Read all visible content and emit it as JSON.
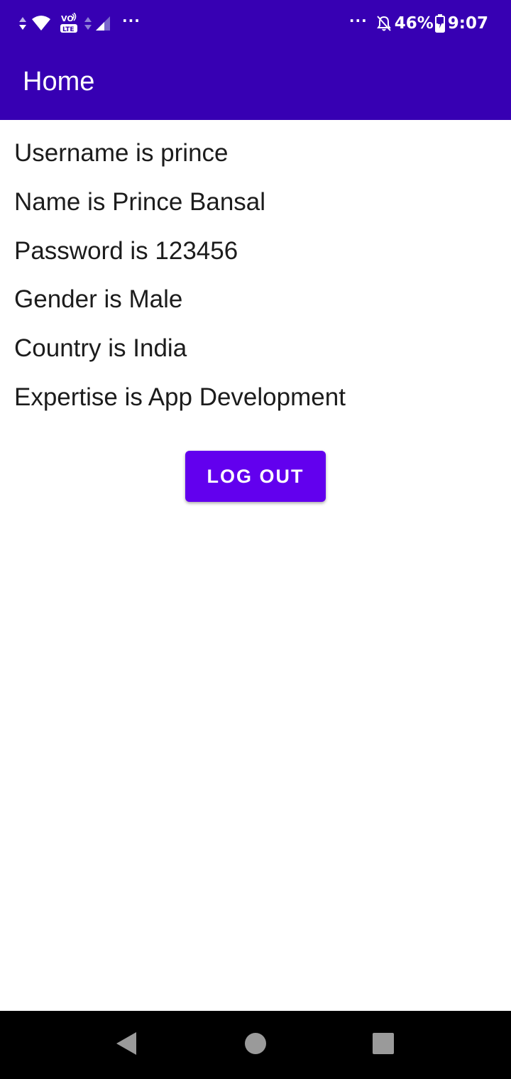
{
  "status_bar": {
    "battery_percent": "46%",
    "time": "9:07",
    "left_dots": "···",
    "right_dots": "···",
    "icons": [
      "data-arrows-icon",
      "wifi-icon",
      "volte-icon",
      "signal-arrows-icon",
      "cell-signal-icon",
      "mute-bell-icon",
      "battery-icon"
    ],
    "volte_label_top": "VO",
    "volte_label_bottom": "LTE"
  },
  "app_bar": {
    "title": "Home"
  },
  "profile": {
    "username_line": "Username is prince",
    "name_line": "Name is Prince Bansal",
    "password_line": "Password is 123456",
    "gender_line": "Gender is Male",
    "country_line": "Country is India",
    "expertise_line": "Expertise is App Development"
  },
  "actions": {
    "logout_label": "LOG OUT"
  },
  "nav_bar": {
    "icons": [
      "back-icon",
      "home-icon",
      "recents-icon"
    ]
  },
  "colors": {
    "app_bar": "#3700b3",
    "button": "#6200ee",
    "nav_bar": "#000000",
    "text": "#1c1c1c"
  }
}
